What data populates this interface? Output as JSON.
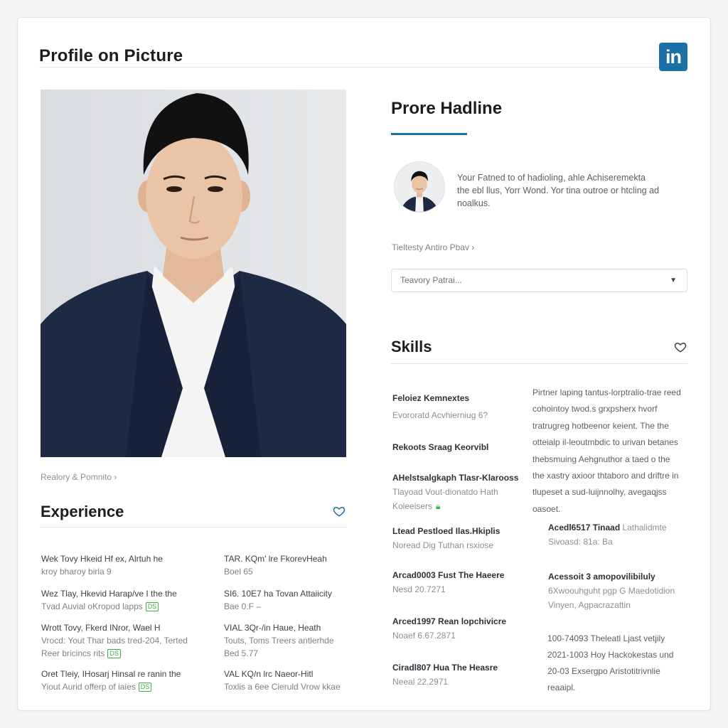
{
  "header": {
    "title": "Profile on Picture",
    "logo_text": "in",
    "logo_color": "#1d6fa8"
  },
  "photo": {
    "caption": "Realory & Pomnito ›"
  },
  "experience": {
    "title": "Experience",
    "items": [
      {
        "l1": "Wek Tovy Hkeid Hf ex, Alrtuh he",
        "l2": "kroy bharoy birla 9",
        "badge": ""
      },
      {
        "l1": "TAR. KQm' lre FkorevHeah",
        "l2": "Boel 65",
        "badge": ""
      },
      {
        "l1": "Wez Tlay, Hkevid Harap/ve I the the",
        "l2": "Tvad Auvial oKropod lapps",
        "badge": "DS"
      },
      {
        "l1": "SI6. 10E7 ha Tovan Attaiicity",
        "l2": "Bae 0.F –",
        "badge": ""
      },
      {
        "l1": "Wrott Tovy, Fkerd INror, Wael H",
        "l2": "Vrocd: Yout Thar bads tred-204, Terted",
        "l3": "Reer bricincs rits",
        "badge": "DS"
      },
      {
        "l1": "VIAL 3Qr-/in Haue, Heath",
        "l2": "Touts, Toms Treers antlerhde",
        "l3": "Bed 5.77",
        "badge": ""
      },
      {
        "l1": "Oret Tleiy, IHosarj Hinsal re ranin the",
        "l2": "Yiout Aurid offerp of iaies",
        "badge": "DS"
      },
      {
        "l1": "VAL KQ/n lrc Naeor-Hitl",
        "l2": "Toxlis a 6ee Cieruld Vrow kkae",
        "badge": ""
      }
    ]
  },
  "headline": {
    "title": "Prore Hadline",
    "about_lines": [
      "Your Fatned to of hadioling, ahle Achiseremekta",
      "the ebl llus, Yorr Wond. Yor tina outroe or htcling ad",
      "noalkus."
    ],
    "field_label": "Tieltesty Antiro Pbav ›",
    "select_value": "Teavory Patrai..."
  },
  "skills": {
    "title": "Skills",
    "left": [
      {
        "name": "Feloiez Kemnextes",
        "sub": "Evororatd Acvhierniug 6?"
      },
      {
        "name": "Rekoots Sraag Keorvibl",
        "sub": ""
      },
      {
        "name": "AHelstsalgkaph Tlasr-Klarooss",
        "sub": "Tlayoad Vout-dionatdo Hath",
        "sub2": "Koleeisers"
      },
      {
        "name": "Ltead Pestloed Ilas.Hkiplis",
        "sub": "Noread Dig Tuthan rsxiose"
      },
      {
        "name": "Arcad0003 Fust The Haeere",
        "sub": "Nesd 20.7271"
      },
      {
        "name": "Arced1997 Rean lopchivicre",
        "sub": "Noaef 6.67.2871"
      },
      {
        "name": "Ciradl807 Hua The Heasre",
        "sub": "Neeal 22.2971"
      }
    ],
    "paragraph": [
      "Pirtner laping tantus-lorptralio-trae reed",
      "cohointoy twod.s grxpsherx hvorf",
      "tratrugreg hotbeenor keient. The the",
      "otteialp il-leoutmbdic to urivan betanes",
      "thebsmuing Aehgnuthor a taed o the",
      "the xastry axioor thtaboro and driftre in",
      "tlupeset a sud-luijnnolhy, avegaqjss",
      "oasoet."
    ],
    "right": [
      {
        "name": "Acedl6517 Tinaad",
        "name_tail": "Lathalidmte",
        "sub": "Sivoasd: 81a: Ba"
      },
      {
        "name": "Acessoit 3 amopovilibiluly",
        "sub": "6Xwoouhguht pgp G Maedotidion",
        "sub2": "Vinyen, Agpacrazattin"
      }
    ],
    "notes": [
      "100-74093 Theleatl Ljast vetjily",
      "2021-1003 Hoy Hackokestas und",
      "20-03 Exsergpo Aristotitrivnlie",
      "reaaipl."
    ]
  }
}
